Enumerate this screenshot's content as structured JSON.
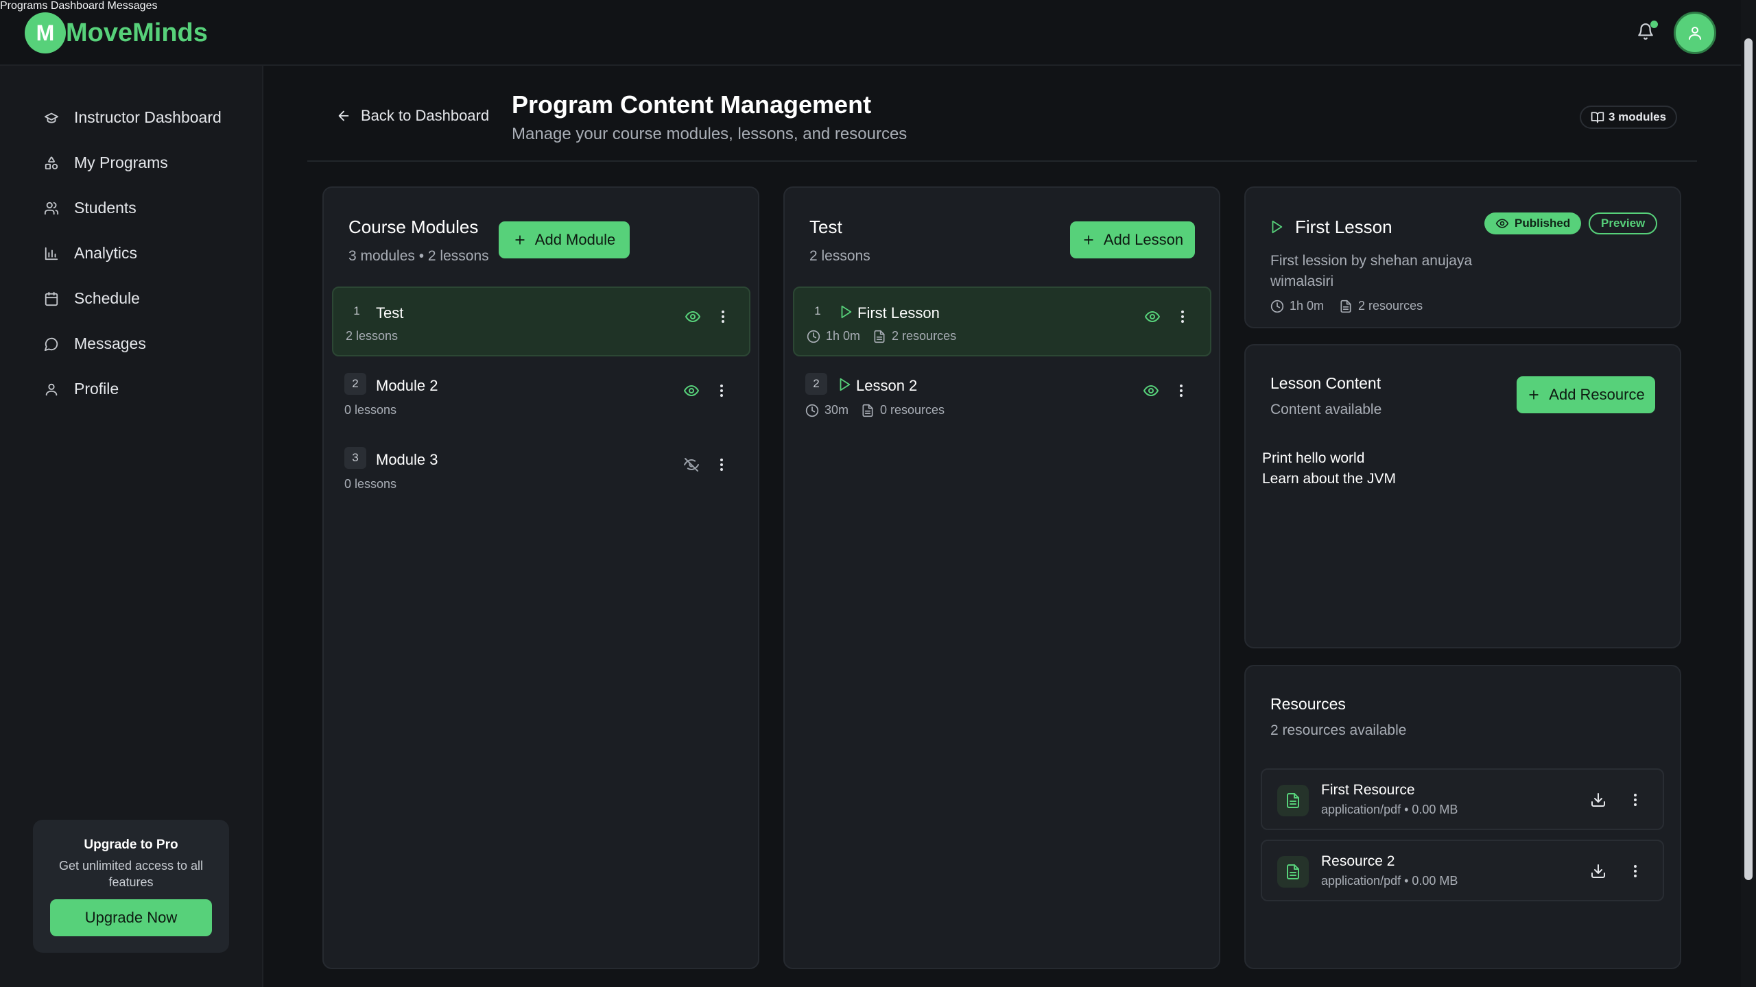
{
  "app": {
    "logo_letter": "M",
    "name": "MoveMinds",
    "accent_color": "#57d17a"
  },
  "topnav": [
    {
      "label": "Programs"
    },
    {
      "label": "Dashboard"
    },
    {
      "label": "Messages"
    }
  ],
  "sidebar": {
    "items": [
      {
        "label": "Instructor Dashboard",
        "icon": "graduation-cap-icon"
      },
      {
        "label": "My Programs",
        "icon": "shapes-icon"
      },
      {
        "label": "Students",
        "icon": "users-icon"
      },
      {
        "label": "Analytics",
        "icon": "bar-chart-icon"
      },
      {
        "label": "Schedule",
        "icon": "calendar-icon"
      },
      {
        "label": "Messages",
        "icon": "message-circle-icon"
      },
      {
        "label": "Profile",
        "icon": "user-icon"
      }
    ],
    "upgrade": {
      "title": "Upgrade to Pro",
      "subtitle": "Get unlimited access to all features",
      "button": "Upgrade Now"
    }
  },
  "header": {
    "back_label": "Back to Dashboard",
    "title": "Program Content Management",
    "subtitle": "Manage your course modules, lessons, and resources",
    "module_count": "3 modules"
  },
  "modules_panel": {
    "title": "Course Modules",
    "summary": "3 modules • 2 lessons",
    "add_label": "Add Module",
    "modules": [
      {
        "num": "1",
        "title": "Test",
        "meta": "2 lessons",
        "visible": true
      },
      {
        "num": "2",
        "title": "Module 2",
        "meta": "0 lessons",
        "visible": true
      },
      {
        "num": "3",
        "title": "Module 3",
        "meta": "0 lessons",
        "visible": false
      }
    ]
  },
  "lessons_panel": {
    "title": "Test",
    "summary": "2 lessons",
    "add_label": "Add Lesson",
    "lessons": [
      {
        "num": "1",
        "title": "First Lesson",
        "duration": "1h 0m",
        "resources": "2 resources"
      },
      {
        "num": "2",
        "title": "Lesson 2",
        "duration": "30m",
        "resources": "0 resources"
      }
    ]
  },
  "lesson_detail": {
    "title": "First Lesson",
    "status": "Published",
    "preview": "Preview",
    "description": "First lession by shehan anujaya wimalasiri",
    "duration": "1h 0m",
    "resources": "2 resources"
  },
  "lesson_content": {
    "title": "Lesson Content",
    "subtitle": "Content available",
    "add_label": "Add Resource",
    "lines": [
      "Print hello world",
      "Learn about the JVM"
    ]
  },
  "resources": {
    "title": "Resources",
    "subtitle": "2 resources available",
    "items": [
      {
        "name": "First Resource",
        "meta": "application/pdf • 0.00 MB"
      },
      {
        "name": "Resource 2",
        "meta": "application/pdf • 0.00 MB"
      }
    ]
  }
}
